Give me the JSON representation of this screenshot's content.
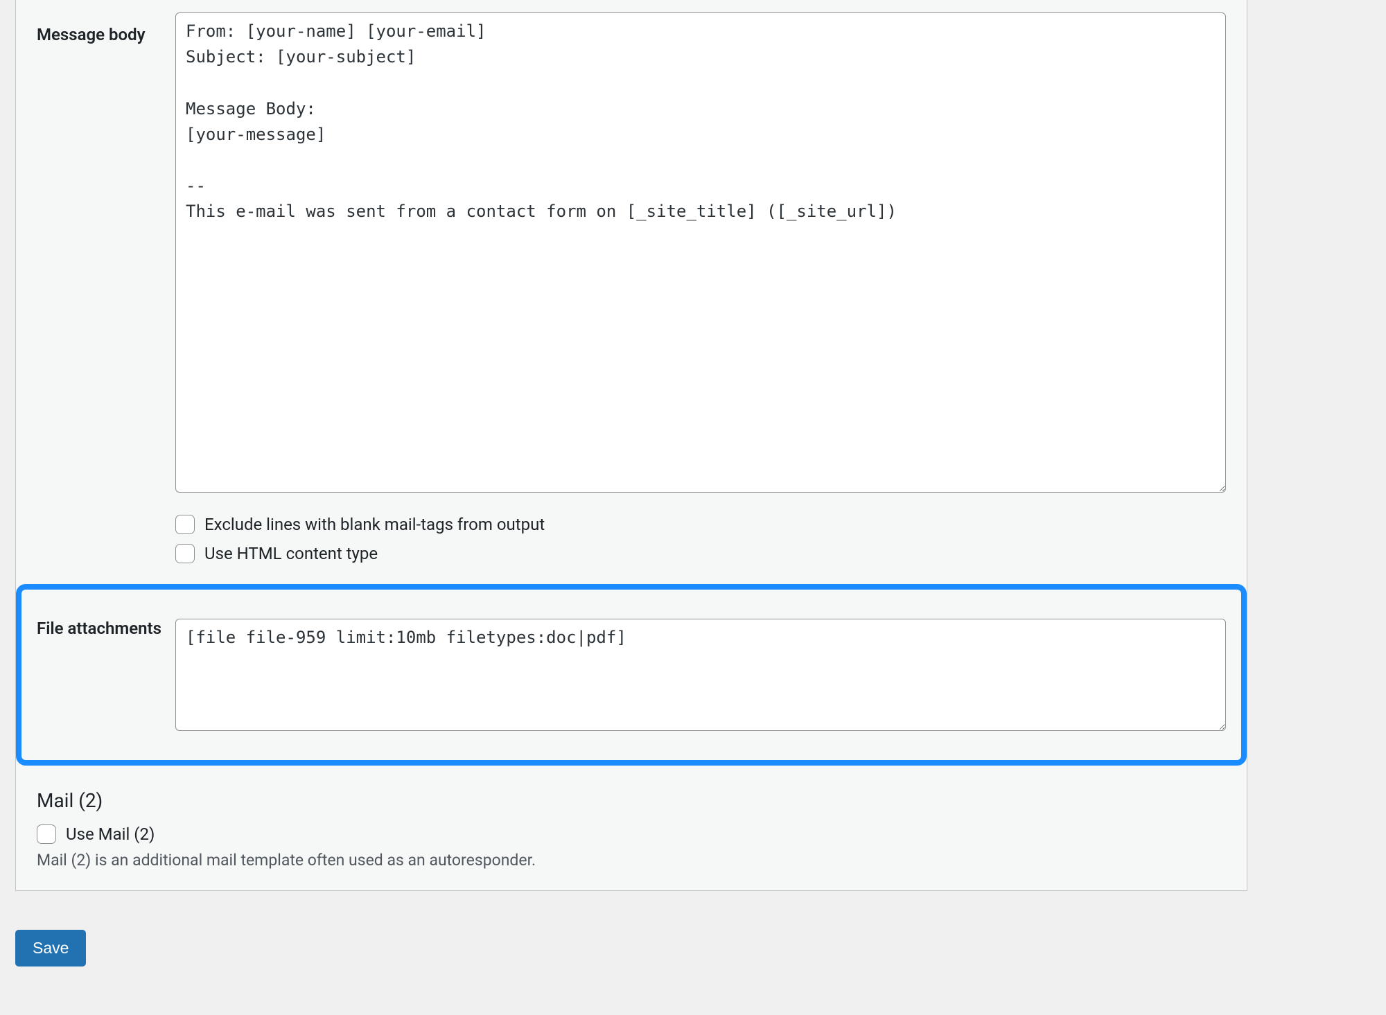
{
  "labels": {
    "message_body": "Message body",
    "file_attachments": "File attachments"
  },
  "fields": {
    "message_body": "From: [your-name] [your-email]\nSubject: [your-subject]\n\nMessage Body:\n[your-message]\n\n--\nThis e-mail was sent from a contact form on [_site_title] ([_site_url])",
    "file_attachments": "[file file-959 limit:10mb filetypes:doc|pdf]"
  },
  "checkboxes": {
    "exclude_blank_label": "Exclude lines with blank mail-tags from output",
    "use_html_label": "Use HTML content type",
    "use_mail2_label": "Use Mail (2)"
  },
  "mail2": {
    "title": "Mail (2)",
    "description": "Mail (2) is an additional mail template often used as an autoresponder."
  },
  "buttons": {
    "save": "Save"
  }
}
